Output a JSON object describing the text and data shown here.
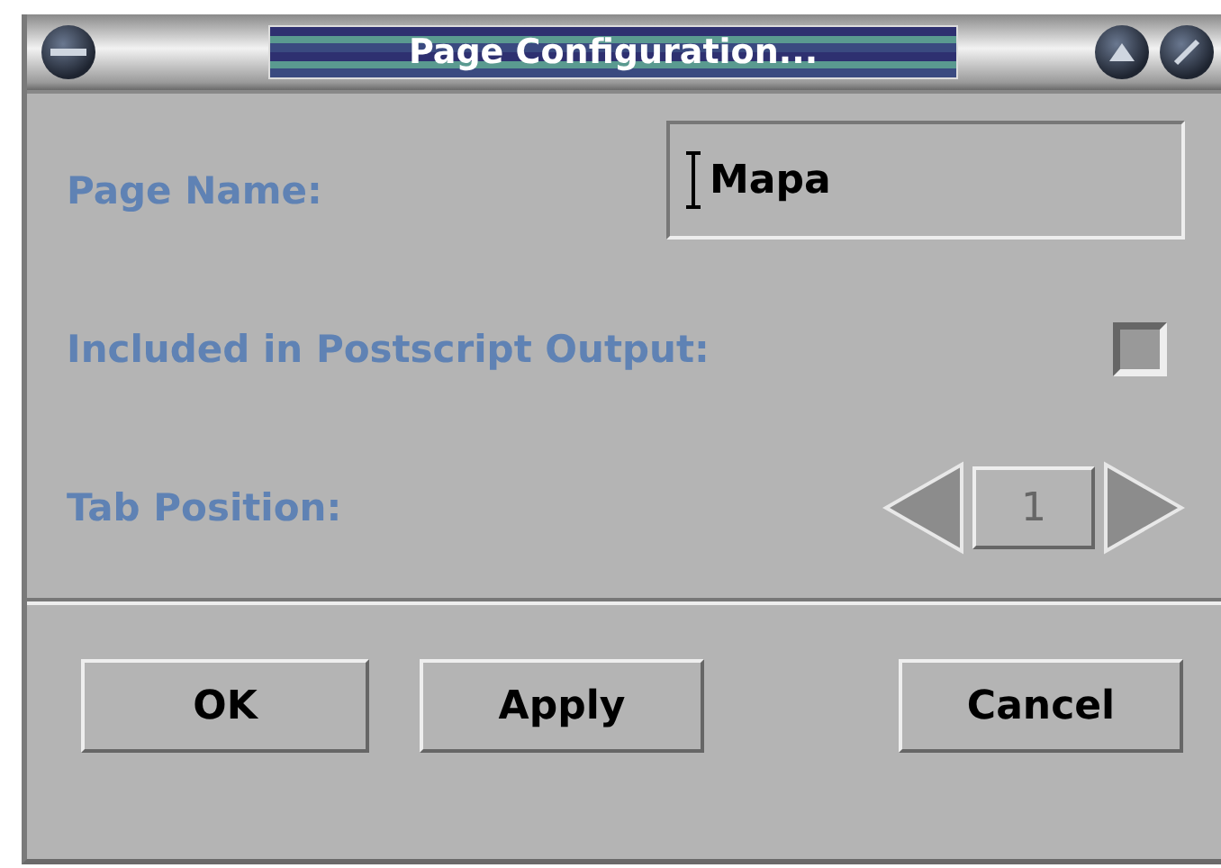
{
  "window": {
    "title": "Page Configuration..."
  },
  "fields": [
    {
      "kind": "text",
      "label": "Page Name:",
      "value": "Mapa"
    },
    {
      "kind": "checkbox",
      "label": "Included in Postscript Output:",
      "checked": false
    },
    {
      "kind": "spinner",
      "label": "Tab Position:",
      "value": "1"
    }
  ],
  "buttons": [
    {
      "label": "OK"
    },
    {
      "label": "Apply"
    },
    {
      "label": "Cancel"
    }
  ]
}
